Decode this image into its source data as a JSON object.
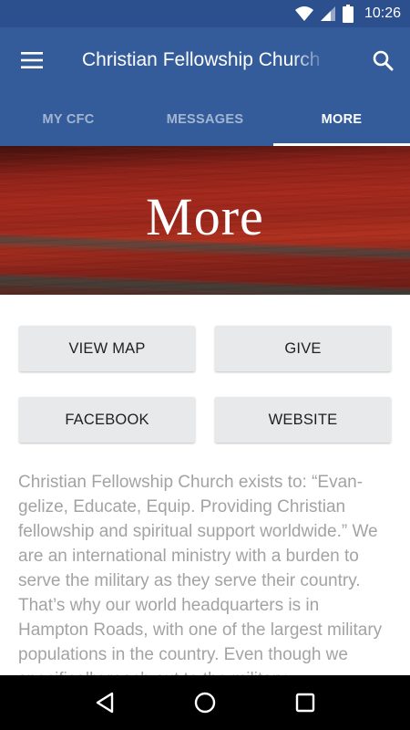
{
  "status_bar": {
    "time": "10:26",
    "icons": [
      "wifi-icon",
      "signal-icon",
      "battery-icon"
    ]
  },
  "app_bar": {
    "title": "Christian Fellowship Church",
    "menu_icon": "hamburger-menu-icon",
    "search_icon": "search-icon"
  },
  "tabs": [
    {
      "label": "MY CFC",
      "active": false
    },
    {
      "label": "MESSAGES",
      "active": false
    },
    {
      "label": "MORE",
      "active": true
    }
  ],
  "banner": {
    "heading": "More"
  },
  "buttons": {
    "view_map": "VIEW MAP",
    "give": "GIVE",
    "facebook": "FACEBOOK",
    "website": "WEBSITE"
  },
  "description": "Christian Fellowship Church exists to: “Evan-gelize, Educate, Equip. Providing Christian fellowship and spiritual support worldwide.” We are an international ministry with a burden to serve the military as they serve their country. That’s why our world headquarters is in Hampton Roads, with one of the largest military populations in the country. Even though we specifically reach out to the military",
  "nav_bar": {
    "icons": [
      "back-icon",
      "home-icon",
      "recents-icon"
    ]
  },
  "colors": {
    "status_bar": "#2c4f8e",
    "app_bar": "#345c9b",
    "button_bg": "#e8e9ea",
    "description_text": "#a3a3a3"
  }
}
